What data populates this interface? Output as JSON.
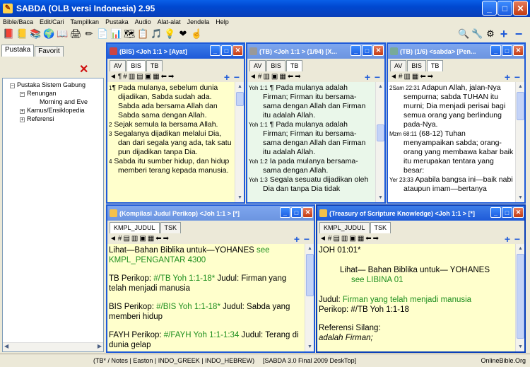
{
  "window": {
    "title": "SABDA (OLB versi Indonesia) 2.95"
  },
  "menu": [
    "Bible/Baca",
    "Edit/Cari",
    "Tampilkan",
    "Pustaka",
    "Audio",
    "Alat-alat",
    "Jendela",
    "Help"
  ],
  "left": {
    "tabs": [
      "Pustaka",
      "Favorit"
    ],
    "tree": [
      "Pustaka Sistem Gabung",
      "Renungan",
      "Morning and Eve",
      "Kamus/Ensiklopedia",
      "Referensi"
    ]
  },
  "pane1": {
    "title": "(BIS) <Joh 1:1 > [Ayat]",
    "tabs": [
      "AV",
      "BIS",
      "TB"
    ],
    "verses": [
      {
        "n": "1",
        "text": "Pada mulanya, sebelum dunia dijadikan, Sabda sudah ada. Sabda ada bersama Allah dan Sabda sama dengan Allah."
      },
      {
        "n": "2",
        "text": "Sejak semula Ia bersama Allah."
      },
      {
        "n": "3",
        "text": "Segalanya dijadikan melalui Dia, dan dari segala yang ada, tak satu pun dijadikan tanpa Dia."
      },
      {
        "n": "4",
        "text": "Sabda itu sumber hidup, dan hidup memberi terang kepada manusia."
      }
    ]
  },
  "pane2": {
    "title": "(TB) <Joh 1:1 > (1/94) [X...",
    "tabs": [
      "AV",
      "BIS",
      "TB"
    ],
    "verses": [
      {
        "n": "Yoh 1:1",
        "text": "Pada mulanya adalah Firman; Firman itu bersama-sama dengan Allah dan Firman itu adalah Allah."
      },
      {
        "n": "Yoh 1:1",
        "text": "Pada mulanya adalah Firman; Firman itu bersama-sama dengan Allah dan Firman itu adalah Allah."
      },
      {
        "n": "Yoh 1:2",
        "text": "Ia pada mulanya bersama-sama dengan Allah."
      },
      {
        "n": "Yoh 1:3",
        "text": "Segala sesuatu dijadikan oleh Dia dan tanpa Dia tidak"
      }
    ]
  },
  "pane3": {
    "title": "(TB) (1/6) <sabda> [Pen...",
    "tabs": [
      "AV",
      "BIS",
      "TB"
    ],
    "verses": [
      {
        "n": "2Sam 22:31",
        "text": "Adapun Allah, jalan-Nya sempurna; sabda TUHAN itu murni; Dia menjadi perisai bagi semua orang yang berlindung pada-Nya."
      },
      {
        "n": "Mzm 68:11",
        "text": "(68-12) Tuhan menyampaikan sabda; orang-orang yang membawa kabar baik itu merupakan tentara yang besar:"
      },
      {
        "n": "Yer 23:33",
        "text": "Apabila bangsa ini—baik nabi ataupun imam—bertanya"
      }
    ]
  },
  "pane4": {
    "title": "(Kompilasi Judul Perikop) <Joh 1:1 > [*]",
    "tabs": [
      "KMPL_JUDUL",
      "TSK"
    ],
    "lines": {
      "l1a": "Lihat—Bahan Biblika untuk—YOHANES",
      "l1b": "see",
      "l1c": "KMPL_PENGANTAR 4300",
      "tb_label": "TB Perikop:",
      "tb_link": "#/TB Yoh 1:1-18*",
      "tb_rest": "Judul: Firman yang telah menjadi manusia",
      "bis_label": "BIS Perikop:",
      "bis_link": "#/BIS Yoh 1:1-18*",
      "bis_rest": "Judul: Sabda yang memberi hidup",
      "fayh_label": "FAYH Perikop:",
      "fayh_link": "#/FAYH Yoh 1:1-1:34",
      "fayh_rest": "Judul: Terang di dunia gelap"
    }
  },
  "pane5": {
    "title": "(Treasury of Scripture Knowledge) <Joh 1:1 > [*]",
    "tabs": [
      "KMPL_JUDUL",
      "TSK"
    ],
    "lines": {
      "ref": "JOH 01:01*",
      "lihat": "Lihat— Bahan Biblika untuk— YOHANES",
      "see": "see LIBINA 01",
      "judul_label": "Judul:",
      "judul_val": "Firman yang telah menjadi manusia",
      "perikop": "Perikop: #/TB Yoh 1:1-18",
      "ref_silang": "Referensi Silang:",
      "adalah": "adalah Firman;"
    }
  },
  "status": {
    "left": "(TB* / Notes | Easton | INDO_GREEK | INDO_HEBREW)",
    "mid": "[SABDA 3.0 Final 2009 DeskTop]",
    "right": "OnlineBible.Org"
  }
}
